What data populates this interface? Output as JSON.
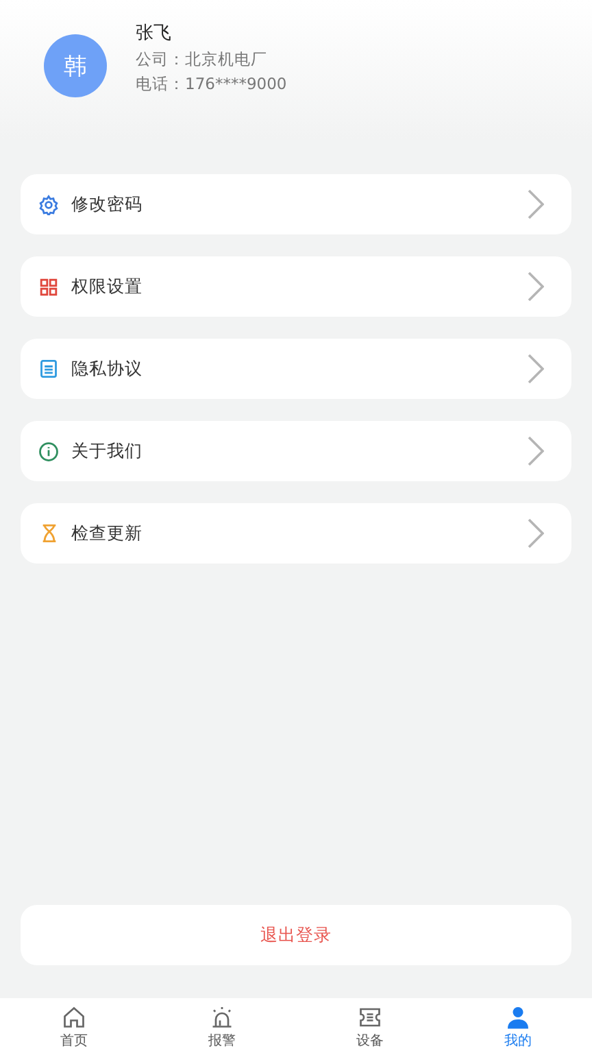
{
  "profile": {
    "avatar_text": "韩",
    "name": "张飞",
    "company": "公司：北京机电厂",
    "phone": "电话：176****9000"
  },
  "menu": [
    {
      "label": "修改密码"
    },
    {
      "label": "权限设置"
    },
    {
      "label": "隐私协议"
    },
    {
      "label": "关于我们"
    },
    {
      "label": "检查更新"
    }
  ],
  "logout": "退出登录",
  "tabs": [
    {
      "label": "首页",
      "selected": false
    },
    {
      "label": "报警",
      "selected": false
    },
    {
      "label": "设备",
      "selected": false
    },
    {
      "label": "我的",
      "selected": true
    }
  ]
}
